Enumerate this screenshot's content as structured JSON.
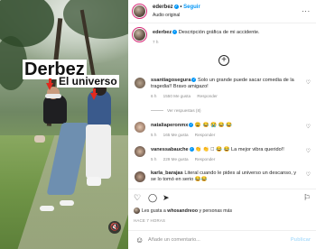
{
  "video": {
    "caption_line1": "Derbez",
    "caption_line2": "El universo",
    "mute_icon": "speaker-muted-icon"
  },
  "header": {
    "username": "ederbez",
    "follow_sep": "•",
    "follow_label": "Seguir",
    "subtitle": "Audio original",
    "more_icon": "..."
  },
  "post": {
    "username": "ederbez",
    "text": "Descripción gráfica de mi accidente.",
    "time": "7 h"
  },
  "comments": [
    {
      "username": "ssantiagosegura",
      "text": "Solo un grande puede sacar comedia de la tragedia!! Bravo amigazo!",
      "time": "6 h",
      "likes": "1550 Me gusta",
      "reply": "Responder",
      "replies": "Ver respuestas (8)"
    },
    {
      "username": "nataliaperonmx",
      "text": "😩 😂 😭 😂 😂",
      "time": "5 h",
      "likes": "165 Me gusta",
      "reply": "Responder"
    },
    {
      "username": "vanessabauche",
      "text": "👏 👏 🏻 😂 😂 La mejor vibra querido!!",
      "time": "5 h",
      "likes": "229 Me gusta",
      "reply": "Responder"
    },
    {
      "username": "karla_barajas",
      "text": "Literal cuando le pides al universo un descanso, y se lo tomó en serio 😂😂",
      "time": "",
      "likes": "",
      "reply": ""
    }
  ],
  "likes_line": {
    "prefix": "Les gusta a",
    "user": "whosandreoo",
    "suffix": "y personas más"
  },
  "date": "HACE 7 HORAS",
  "add_comment": {
    "placeholder": "Añade un comentario...",
    "publish": "Publicar"
  },
  "colors": {
    "accent": "#0095f6",
    "text": "#262626",
    "muted": "#8e8e8e",
    "arrow": "#e02a1e"
  }
}
